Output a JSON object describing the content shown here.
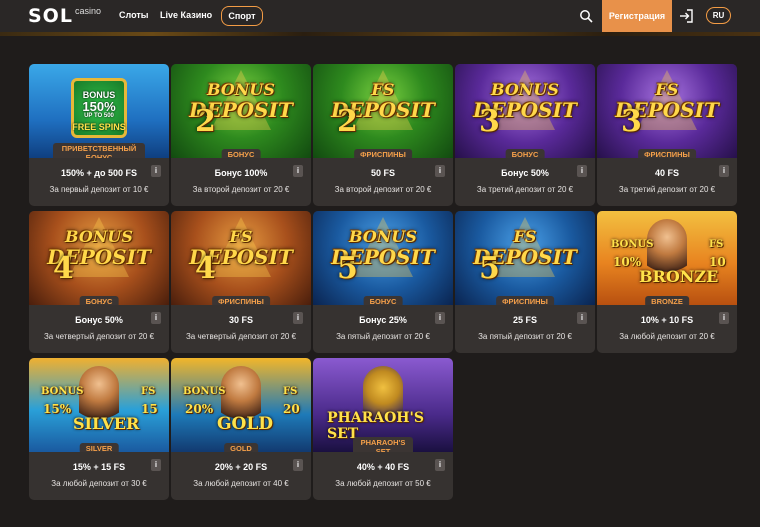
{
  "header": {
    "logo_text": "SOL",
    "logo_sub": "casino",
    "nav": [
      "Слоты",
      "Live Казино"
    ],
    "sport": "Спорт",
    "register": "Регистрация",
    "lang": "RU"
  },
  "cards": [
    {
      "tag": "ПРИВЕТСТВЕННЫЙ БОНУС",
      "title": "150% + до 500 FS",
      "desc": "За первый депозит от 10 €",
      "img": {
        "w1": "BONUS",
        "w2": "150%",
        "w3": "UP TO 500",
        "w4": "FREE SPINS"
      }
    },
    {
      "tag": "БОНУС",
      "title": "Бонус 100%",
      "desc": "За второй депозит от 20 €",
      "img": {
        "l1": "BONUS",
        "num": "2",
        "l2": "DEPOSIT"
      }
    },
    {
      "tag": "ФРИСПИНЫ",
      "title": "50 FS",
      "desc": "За второй депозит от 20 €",
      "img": {
        "l1": "FS",
        "num": "2",
        "l2": "DEPOSIT"
      }
    },
    {
      "tag": "БОНУС",
      "title": "Бонус 50%",
      "desc": "За третий депозит от 20 €",
      "img": {
        "l1": "BONUS",
        "num": "3",
        "l2": "DEPOSIT"
      }
    },
    {
      "tag": "ФРИСПИНЫ",
      "title": "40 FS",
      "desc": "За третий депозит от 20 €",
      "img": {
        "l1": "FS",
        "num": "3",
        "l2": "DEPOSIT"
      }
    },
    {
      "tag": "БОНУС",
      "title": "Бонус 50%",
      "desc": "За четвертый депозит от 20 €",
      "img": {
        "l1": "BONUS",
        "num": "4",
        "l2": "DEPOSIT"
      }
    },
    {
      "tag": "ФРИСПИНЫ",
      "title": "30 FS",
      "desc": "За четвертый депозит от 20 €",
      "img": {
        "l1": "FS",
        "num": "4",
        "l2": "DEPOSIT"
      }
    },
    {
      "tag": "БОНУС",
      "title": "Бонус 25%",
      "desc": "За пятый депозит от 20 €",
      "img": {
        "l1": "BONUS",
        "num": "5",
        "l2": "DEPOSIT"
      }
    },
    {
      "tag": "ФРИСПИНЫ",
      "title": "25 FS",
      "desc": "За пятый депозит от 20 €",
      "img": {
        "l1": "FS",
        "num": "5",
        "l2": "DEPOSIT"
      }
    },
    {
      "tag": "BRONZE",
      "title": "10% + 10 FS",
      "desc": "За любой депозит от 20 €",
      "img": {
        "a": "BONUS",
        "b": "10%",
        "c": "BRONZE",
        "d": "FS",
        "e": "10"
      }
    },
    {
      "tag": "SILVER",
      "title": "15% + 15 FS",
      "desc": "За любой депозит от 30 €",
      "img": {
        "a": "BONUS",
        "b": "15%",
        "c": "SILVER",
        "d": "FS",
        "e": "15"
      }
    },
    {
      "tag": "GOLD",
      "title": "20% + 20 FS",
      "desc": "За любой депозит от 40 €",
      "img": {
        "a": "BONUS",
        "b": "20%",
        "c": "GOLD",
        "d": "FS",
        "e": "20"
      }
    },
    {
      "tag": "PHARAOH'S SET",
      "title": "40% + 40 FS",
      "desc": "За любой депозит от 50 €",
      "img": {
        "c": "PHARAOH'S SET"
      }
    }
  ],
  "info_label": "i"
}
